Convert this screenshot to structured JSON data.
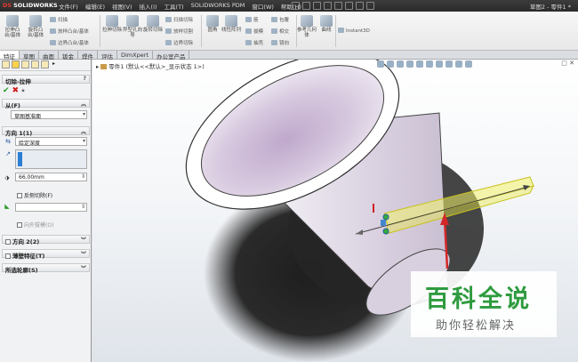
{
  "app": {
    "logo": "SOLIDWORKS",
    "doc_title": "草图2 - 零件1 *"
  },
  "menu": [
    "文件(F)",
    "编辑(E)",
    "视图(V)",
    "插入(I)",
    "工具(T)",
    "SOLIDWORKS PDM",
    "窗口(W)",
    "帮助(H)"
  ],
  "commands": {
    "extrude_boss": "拉伸凸台/基体",
    "revolve_boss": "旋转凸台/基体",
    "sweep": "扫描",
    "loft_boss": "放样凸台/基体",
    "boundary_boss": "边界凸台/基体",
    "extrude_cut": "拉伸切除",
    "hole_wizard": "异型孔向导",
    "revolve_cut": "旋转切除",
    "sweep_cut": "扫描切除",
    "loft_cut": "放样切割",
    "boundary_cut": "边界切除",
    "fillet": "圆角",
    "linear_pattern": "线性阵列",
    "rib": "筋",
    "draft": "拔模",
    "shell": "抽壳",
    "wrap": "包覆",
    "intersect": "相交",
    "mirror": "镜向",
    "ref_geometry": "参考几何体",
    "curves": "曲线",
    "instant3d": "Instant3D"
  },
  "tabs": [
    "特征",
    "草图",
    "曲面",
    "钣金",
    "焊件",
    "评估",
    "DimXpert",
    "办公室产品"
  ],
  "panel": {
    "title": "切除-拉伸",
    "from_header": "从(F)",
    "from_value": "草图基准面",
    "dir1_header": "方向 1(1)",
    "end_condition": "给定深度",
    "depth": "66.00mm",
    "flip_side": "反侧切除(F)",
    "draft_outward": "向外拔模(O)",
    "dir2_header": "方向 2(2)",
    "thin_feature": "薄壁特征(T)",
    "selected_contours": "所选轮廓(S)"
  },
  "viewport": {
    "tree_label": "零件1 (默认<<默认>_显示状态 1>)"
  },
  "watermark": {
    "line1": "百科全说",
    "line2": "助你轻松解决"
  },
  "colors": {
    "accent_green": "#2e9b3e",
    "preview_yellow": "#e8e84a",
    "model_body": "#e8e2ec"
  }
}
